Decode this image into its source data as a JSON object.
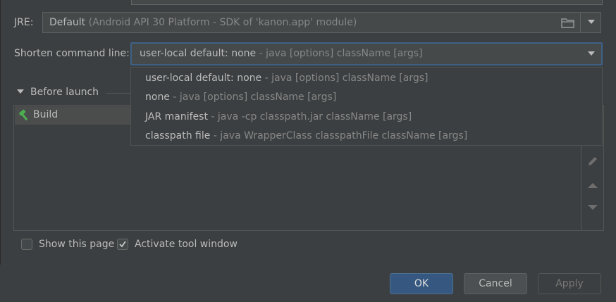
{
  "jre": {
    "label": "JRE:",
    "value": "Default",
    "detail": "(Android API 30 Platform - SDK of 'kanon.app' module)",
    "icon": "folder-icon"
  },
  "shorten": {
    "label": "Shorten command line:",
    "selected": {
      "main": "user-local default: none",
      "hint": " - java [options] className [args]"
    },
    "options": [
      {
        "main": "user-local default: none",
        "hint": " - java [options] className [args]"
      },
      {
        "main": "none",
        "hint": " - java [options] className [args]"
      },
      {
        "main": "JAR manifest",
        "hint": " - java -cp classpath.jar className [args]"
      },
      {
        "main": "classpath file",
        "hint": " - java WrapperClass classpathFile className [args]"
      }
    ]
  },
  "before_launch": {
    "title": "Before launch",
    "tasks": [
      {
        "label": "Build",
        "icon": "hammer-icon"
      }
    ],
    "side_icons": [
      "pencil-icon",
      "move-up-icon",
      "move-down-icon"
    ]
  },
  "options": {
    "show_page": {
      "label": "Show this page",
      "checked": false
    },
    "activate_tool": {
      "label": "Activate tool window",
      "checked": true
    }
  },
  "buttons": {
    "ok": "OK",
    "cancel": "Cancel",
    "apply": "Apply"
  },
  "colors": {
    "accent": "#365880",
    "focus_border": "#3d6185",
    "background": "#3c3f41",
    "hammer": "#4caf50"
  }
}
